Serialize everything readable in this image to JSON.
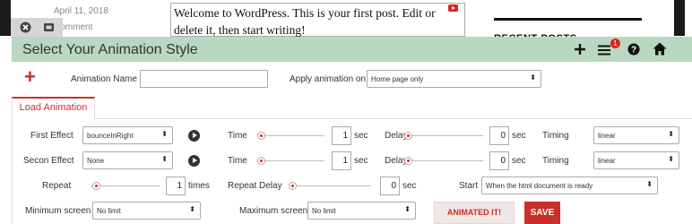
{
  "background": {
    "date": "April 11, 2018",
    "comment": "Comment",
    "post_text": "Welcome to WordPress. This is your first post. Edit or delete it, then start writing!",
    "recent_posts": "RECENT POSTS"
  },
  "header": {
    "title": "Select Your Animation Style",
    "badge": "1"
  },
  "form": {
    "animation_name_label": "Animation Name",
    "animation_name_value": "",
    "apply_on_label": "Apply animation on",
    "apply_on_value": "Home page only"
  },
  "tab": {
    "label": "Load Animation"
  },
  "first_effect": {
    "label": "First Effect",
    "value": "bounceInRight",
    "time_label": "Time",
    "time_value": "1",
    "time_unit": "sec",
    "delay_label": "Delay",
    "delay_value": "0",
    "delay_unit": "sec",
    "timing_label": "Timing",
    "timing_value": "linear"
  },
  "second_effect": {
    "label": "Secon Effect",
    "value": "None",
    "time_label": "Time",
    "time_value": "1",
    "time_unit": "sec",
    "delay_label": "Delay",
    "delay_value": "0",
    "delay_unit": "sec",
    "timing_label": "Timing",
    "timing_value": "linear"
  },
  "repeat": {
    "label": "Repeat",
    "value": "1",
    "unit": "times",
    "delay_label": "Repeat Delay",
    "delay_value": "0",
    "delay_unit": "sec",
    "start_label": "Start",
    "start_value": "When the html document is ready"
  },
  "screen": {
    "min_label": "Minimum screen",
    "min_value": "No limit",
    "max_label": "Maximum screen",
    "max_value": "No limit"
  },
  "buttons": {
    "animate": "ANIMATED IT!",
    "save": "SAVE"
  },
  "colors": {
    "header_bg": "#b8d8c2",
    "accent_red": "#c9302c"
  }
}
